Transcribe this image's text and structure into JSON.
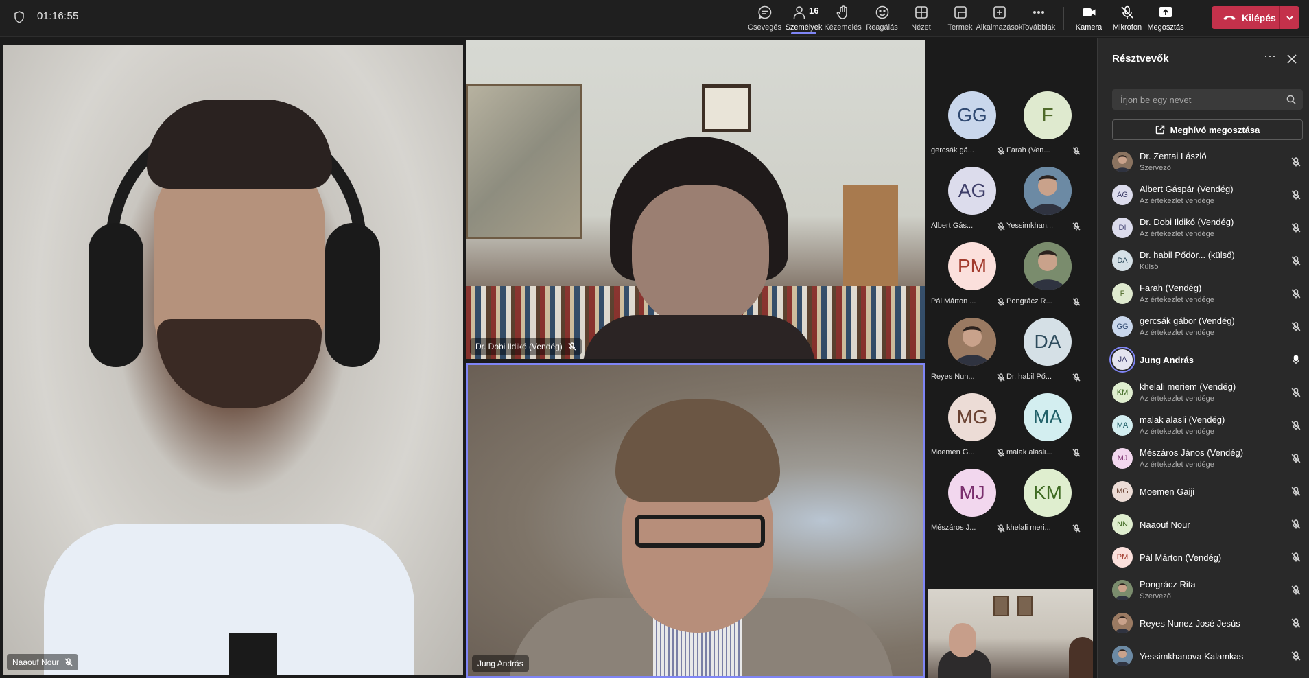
{
  "topbar": {
    "timer": "01:16:55",
    "tools": [
      {
        "label": "Csevegés",
        "icon": "chat-icon"
      },
      {
        "label": "Személyek",
        "icon": "people-icon",
        "count": "16",
        "active": true
      },
      {
        "label": "Kézemelés",
        "icon": "raise-hand-icon"
      },
      {
        "label": "Reagálás",
        "icon": "react-icon"
      },
      {
        "label": "Nézet",
        "icon": "view-icon"
      },
      {
        "label": "Termek",
        "icon": "rooms-icon"
      },
      {
        "label": "Alkalmazások",
        "icon": "apps-icon"
      },
      {
        "label": "Továbbiak",
        "icon": "more-icon"
      }
    ],
    "camera_label": "Kamera",
    "mic_label": "Mikrofon",
    "share_label": "Megosztás",
    "leave_label": "Kilépés",
    "leave_color": "#c4314b",
    "accent_color": "#7f85f5"
  },
  "stage": {
    "naaouf_name": "Naaouf Nour",
    "dobi_name": "Dr. Dobi Ildikó (Vendég)",
    "jung_name": "Jung András",
    "roster": [
      {
        "initials": "GG",
        "name": "gercsák gá...",
        "bg": "#c9d7ec",
        "fg": "#304a72"
      },
      {
        "initials": "F",
        "name": "Farah (Ven...",
        "bg": "#dfeacf",
        "fg": "#4f6a2a"
      },
      {
        "initials": "AG",
        "name": "Albert Gás...",
        "bg": "#dcdcec",
        "fg": "#3f3f6a"
      },
      {
        "initials": "",
        "name": "Yessimkhan...",
        "bg": "#6c8aa4",
        "fg": "#fff",
        "photo": true
      },
      {
        "initials": "PM",
        "name": "Pál Márton ...",
        "bg": "#fbe0dc",
        "fg": "#a23a2c"
      },
      {
        "initials": "",
        "name": "Pongrácz R...",
        "bg": "#7a8c6d",
        "fg": "#fff",
        "photo": true
      },
      {
        "initials": "",
        "name": "Reyes Nun...",
        "bg": "#9a7a62",
        "fg": "#fff",
        "photo": true
      },
      {
        "initials": "DA",
        "name": "Dr. habil Pő...",
        "bg": "#d5e0e6",
        "fg": "#2e4c5d"
      },
      {
        "initials": "MG",
        "name": "Moemen G...",
        "bg": "#ecdcd6",
        "fg": "#6a4232"
      },
      {
        "initials": "MA",
        "name": "malak alasli...",
        "bg": "#d3eef0",
        "fg": "#226169"
      },
      {
        "initials": "MJ",
        "name": "Mészáros J...",
        "bg": "#f2d7ee",
        "fg": "#7a2f6e"
      },
      {
        "initials": "KM",
        "name": "khelali meri...",
        "bg": "#dfeecf",
        "fg": "#3e6a22"
      }
    ]
  },
  "panel": {
    "title": "Résztvevők",
    "search_placeholder": "Írjon be egy nevet",
    "invite_label": "Meghívó megosztása",
    "participants": [
      {
        "initials": "",
        "name": "Dr. Zentai László",
        "sub": "Szervező",
        "bg": "#8a7360",
        "fg": "#fff",
        "photo": true,
        "mic": "muted"
      },
      {
        "initials": "AG",
        "name": "Albert Gáspár (Vendég)",
        "sub": "Az értekezlet vendége",
        "bg": "#dcdcec",
        "fg": "#3f3f6a",
        "mic": "muted"
      },
      {
        "initials": "DI",
        "name": "Dr. Dobi Ildikó (Vendég)",
        "sub": "Az értekezlet vendége",
        "bg": "#dcdcec",
        "fg": "#4a4a78",
        "mic": "muted"
      },
      {
        "initials": "DA",
        "name": "Dr. habil Pődör... (külső)",
        "sub": "Külső",
        "bg": "#d5e0e6",
        "fg": "#2e4c5d",
        "mic": "muted"
      },
      {
        "initials": "F",
        "name": "Farah (Vendég)",
        "sub": "Az értekezlet vendége",
        "bg": "#dfeacf",
        "fg": "#4f6a2a",
        "mic": "muted"
      },
      {
        "initials": "GG",
        "name": "gercsák gábor (Vendég)",
        "sub": "Az értekezlet vendége",
        "bg": "#c9d7ec",
        "fg": "#304a72",
        "mic": "muted"
      },
      {
        "initials": "JA",
        "name": "Jung András",
        "sub": "",
        "bg": "#e4e4f0",
        "fg": "#3a3a6a",
        "mic": "on",
        "speaking": true
      },
      {
        "initials": "KM",
        "name": "khelali meriem (Vendég)",
        "sub": "Az értekezlet vendége",
        "bg": "#dfeecf",
        "fg": "#3e6a22",
        "mic": "muted"
      },
      {
        "initials": "MA",
        "name": "malak alasli (Vendég)",
        "sub": "Az értekezlet vendége",
        "bg": "#d3eef0",
        "fg": "#226169",
        "mic": "muted"
      },
      {
        "initials": "MJ",
        "name": "Mészáros János (Vendég)",
        "sub": "Az értekezlet vendége",
        "bg": "#f2d7ee",
        "fg": "#7a2f6e",
        "mic": "muted"
      },
      {
        "initials": "MG",
        "name": "Moemen Gaiji",
        "sub": "",
        "bg": "#ecdcd6",
        "fg": "#6a4232",
        "mic": "muted"
      },
      {
        "initials": "NN",
        "name": "Naaouf Nour",
        "sub": "",
        "bg": "#dfeecf",
        "fg": "#3e6a22",
        "mic": "muted"
      },
      {
        "initials": "PM",
        "name": "Pál Márton (Vendég)",
        "sub": "",
        "bg": "#fbe0dc",
        "fg": "#a23a2c",
        "mic": "muted"
      },
      {
        "initials": "",
        "name": "Pongrácz Rita",
        "sub": "Szervező",
        "bg": "#7a8c6d",
        "fg": "#fff",
        "photo": true,
        "mic": "muted"
      },
      {
        "initials": "",
        "name": "Reyes Nunez José Jesús",
        "sub": "",
        "bg": "#9a7a62",
        "fg": "#fff",
        "photo": true,
        "mic": "muted"
      },
      {
        "initials": "",
        "name": "Yessimkhanova Kalamkas",
        "sub": "",
        "bg": "#6c8aa4",
        "fg": "#fff",
        "photo": true,
        "mic": "muted"
      }
    ]
  }
}
